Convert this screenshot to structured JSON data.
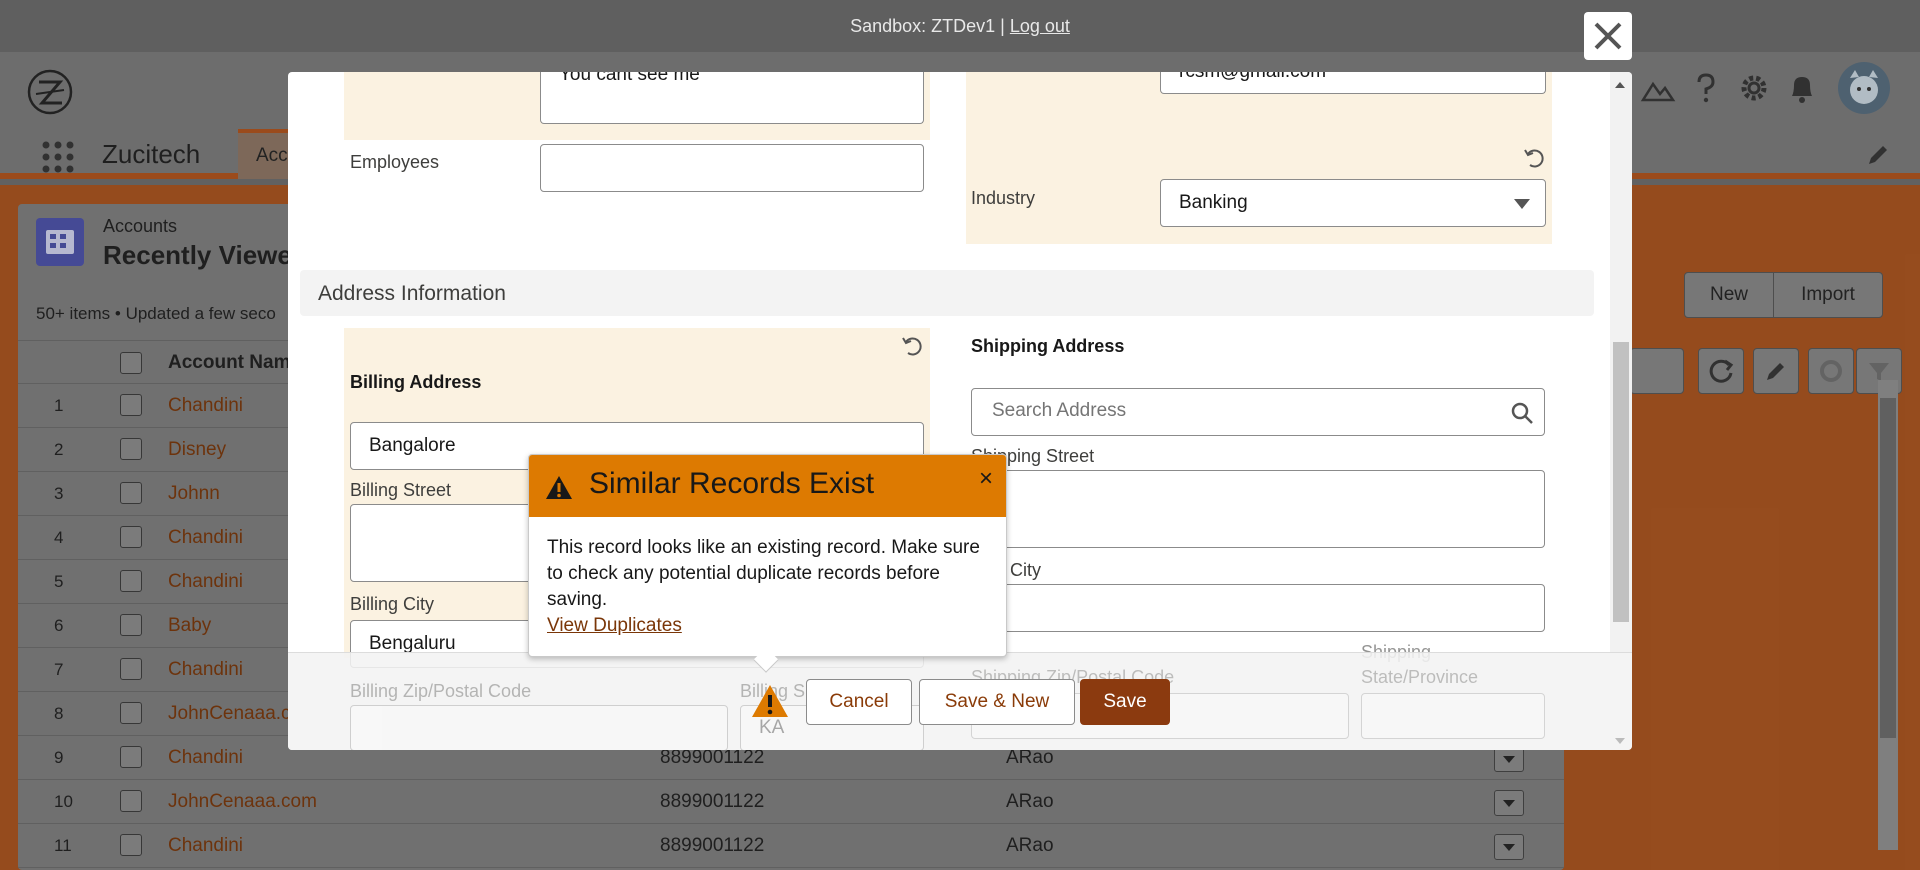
{
  "banner": {
    "text": "Sandbox: ZTDev1 |",
    "logout": "Log out"
  },
  "nav": {
    "app_name": "Zucitech",
    "tab_fragment": "Acc"
  },
  "list": {
    "object_label": "Accounts",
    "view_title": "Recently Viewe",
    "status": "50+ items • Updated a few seco",
    "col_account_name": "Account Nam",
    "buttons": {
      "new": "New",
      "import": "Import"
    },
    "rows": [
      {
        "num": "1",
        "name": "Chandini",
        "phone": "",
        "owner": ""
      },
      {
        "num": "2",
        "name": "Disney",
        "phone": "",
        "owner": ""
      },
      {
        "num": "3",
        "name": "Johnn",
        "phone": "",
        "owner": ""
      },
      {
        "num": "4",
        "name": "Chandini",
        "phone": "",
        "owner": ""
      },
      {
        "num": "5",
        "name": "Chandini",
        "phone": "",
        "owner": ""
      },
      {
        "num": "6",
        "name": "Baby",
        "phone": "",
        "owner": ""
      },
      {
        "num": "7",
        "name": "Chandini",
        "phone": "",
        "owner": ""
      },
      {
        "num": "8",
        "name": "JohnCenaaa.c",
        "phone": "",
        "owner": ""
      },
      {
        "num": "9",
        "name": "Chandini",
        "phone": "8899001122",
        "owner": "ARao"
      },
      {
        "num": "10",
        "name": "JohnCenaaa.com",
        "phone": "8899001122",
        "owner": "ARao"
      },
      {
        "num": "11",
        "name": "Chandini",
        "phone": "8899001122",
        "owner": "ARao"
      }
    ]
  },
  "form": {
    "description_value": "You cant see me",
    "email_value": "rcsm@gmail.com",
    "employees_label": "Employees",
    "employees_value": "",
    "industry_label": "Industry",
    "industry_value": "Banking",
    "address_section": "Address Information",
    "billing_header": "Billing Address",
    "billing_search_value": "Bangalore",
    "billing_street_label": "Billing Street",
    "billing_city_label": "Billing City",
    "billing_city_value": "Bengaluru",
    "billing_zip_label": "Billing Zip/Postal Code",
    "billing_state_label": "Billing S",
    "billing_state_value": "KA",
    "shipping_header": "Shipping Address",
    "shipping_search_placeholder": "Search Address",
    "shipping_street_label": "Shipping Street",
    "shipping_city_label": "ping City",
    "shipping_zip_label": "Shipping Zip/Postal Code",
    "shipping_state_label_1": "Shipping",
    "shipping_state_label_2": "State/Province"
  },
  "footer": {
    "cancel": "Cancel",
    "save_new": "Save & New",
    "save": "Save"
  },
  "popover": {
    "title": "Similar Records Exist",
    "body": "This record looks like an existing record. Make sure to check any potential duplicate records before saving.",
    "link": "View Duplicates",
    "close": "×"
  },
  "colors": {
    "brand": "#8b3a0f",
    "warning": "#dd7a01",
    "link": "#7a3608",
    "highlight": "#fbf2e1"
  },
  "icons": [
    "logo-icon",
    "waffle-icon",
    "search-icon",
    "undo-icon",
    "warning-icon",
    "close-icon",
    "help-icon",
    "gear-icon",
    "bell-icon",
    "chevron-down-icon",
    "refresh-icon",
    "pencil-icon",
    "chart-icon",
    "filter-icon"
  ]
}
